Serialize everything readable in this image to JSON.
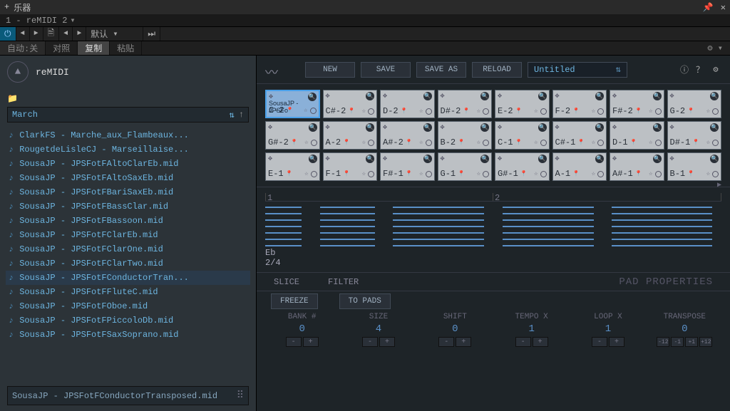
{
  "titlebar": {
    "plus": "+",
    "title": "乐器"
  },
  "subbar": {
    "label": "1 - reMIDI 2"
  },
  "toolbar": {
    "menu_default": "默认"
  },
  "tabs": {
    "auto": "自动:",
    "off": "关",
    "t1": "对照",
    "t2": "复制",
    "t3": "粘贴"
  },
  "left": {
    "logo": "reMIDI",
    "category": "March",
    "files": [
      "ClarkFS - Marche_aux_Flambeaux...",
      "RougetdeLisleCJ - Marseillaise...",
      "SousaJP - JPSFotFAltoClarEb.mid",
      "SousaJP - JPSFotFAltoSaxEb.mid",
      "SousaJP - JPSFotFBariSaxEb.mid",
      "SousaJP - JPSFotFBassClar.mid",
      "SousaJP - JPSFotFBassoon.mid",
      "SousaJP - JPSFotFClarEb.mid",
      "SousaJP - JPSFotFClarOne.mid",
      "SousaJP - JPSFotFClarTwo.mid",
      "SousaJP - JPSFotFConductorTran...",
      "SousaJP - JPSFotFFluteC.mid",
      "SousaJP - JPSFotFOboe.mid",
      "SousaJP - JPSFotFPiccoloDb.mid",
      "SousaJP - JPSFotFSaxSoprano.mid"
    ],
    "selected_index": 10,
    "current": "SousaJP - JPSFotFConductorTransposed.mid"
  },
  "actions": {
    "new": "NEW",
    "save": "SAVE",
    "saveas": "SAVE AS",
    "reload": "RELOAD"
  },
  "doc_title": "Untitled",
  "pads": [
    {
      "label": "C-2",
      "name": "SousaJP - JPSFo",
      "sel": true
    },
    {
      "label": "C#-2"
    },
    {
      "label": "D-2"
    },
    {
      "label": "D#-2"
    },
    {
      "label": "E-2"
    },
    {
      "label": "F-2"
    },
    {
      "label": "F#-2"
    },
    {
      "label": "G-2"
    },
    {
      "label": "G#-2"
    },
    {
      "label": "A-2"
    },
    {
      "label": "A#-2"
    },
    {
      "label": "B-2"
    },
    {
      "label": "C-1"
    },
    {
      "label": "C#-1"
    },
    {
      "label": "D-1"
    },
    {
      "label": "D#-1"
    },
    {
      "label": "E-1"
    },
    {
      "label": "F-1"
    },
    {
      "label": "F#-1"
    },
    {
      "label": "G-1"
    },
    {
      "label": "G#-1"
    },
    {
      "label": "A-1"
    },
    {
      "label": "A#-1"
    },
    {
      "label": "B-1"
    }
  ],
  "midi": {
    "key": "Eb",
    "sig": "2/4",
    "m1": "1",
    "m2": "2"
  },
  "panel": {
    "slice": "SLICE",
    "filter": "FILTER",
    "padprop": "PAD PROPERTIES",
    "freeze": "FREEZE",
    "topads": "TO PADS"
  },
  "params": [
    {
      "label": "BANK #",
      "value": "0",
      "btns": [
        "-",
        "+"
      ]
    },
    {
      "label": "SIZE",
      "value": "4",
      "btns": [
        "-",
        "+"
      ]
    },
    {
      "label": "SHIFT",
      "value": "0",
      "btns": [
        "-",
        "+"
      ]
    },
    {
      "label": "TEMPO X",
      "value": "1",
      "btns": [
        "-",
        "+"
      ]
    },
    {
      "label": "LOOP X",
      "value": "1",
      "btns": [
        "-",
        "+"
      ]
    },
    {
      "label": "TRANSPOSE",
      "value": "0",
      "btns": [
        "-12",
        "-1",
        "+1",
        "+12"
      ]
    }
  ]
}
